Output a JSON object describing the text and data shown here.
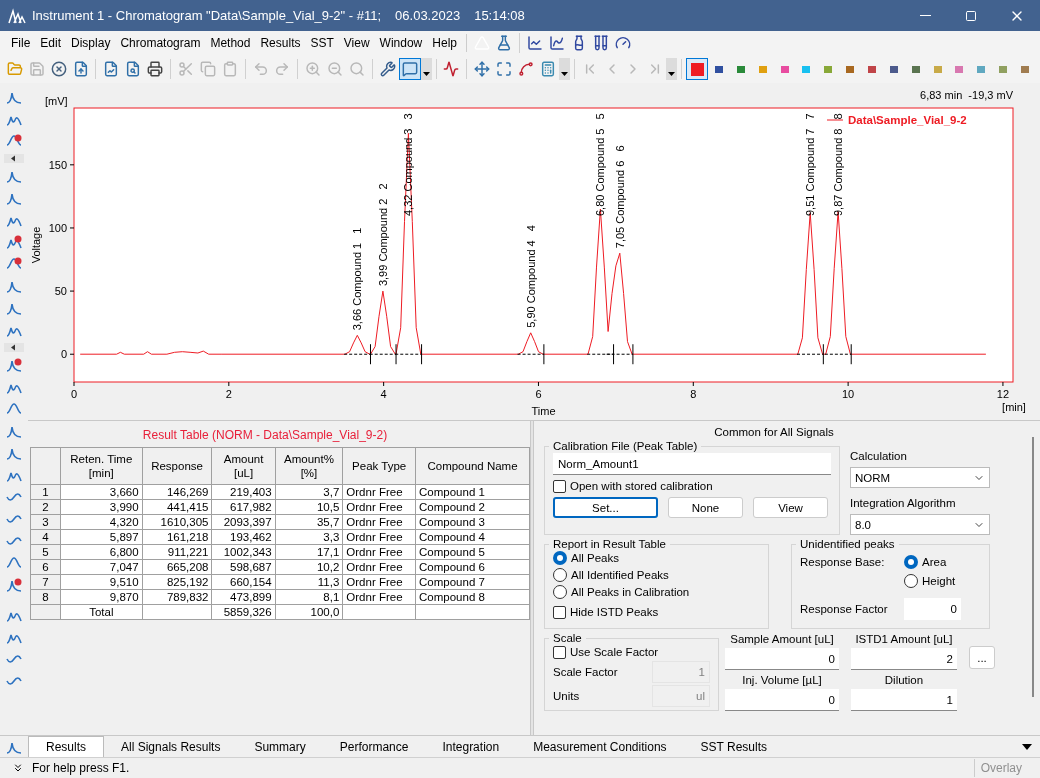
{
  "window": {
    "app": "Instrument 1 - Chromatogram \"Data\\Sample_Vial_9-2\" - #11;",
    "date": "06.03.2023",
    "time": "15:14:08"
  },
  "menu": [
    "File",
    "Edit",
    "Display",
    "Chromatogram",
    "Method",
    "Results",
    "SST",
    "View",
    "Window",
    "Help"
  ],
  "swatches": [
    {
      "color": "#ee1c24",
      "selected": true
    },
    {
      "color": "#3050a0",
      "selected": false
    },
    {
      "color": "#2a8a3a",
      "selected": false
    },
    {
      "color": "#e0a010",
      "selected": false
    },
    {
      "color": "#e84ca0",
      "selected": false
    },
    {
      "color": "#18c0f0",
      "selected": false
    },
    {
      "color": "#88a838",
      "selected": false
    },
    {
      "color": "#a86820",
      "selected": false
    },
    {
      "color": "#c04448",
      "selected": false
    },
    {
      "color": "#4c5a8c",
      "selected": false
    },
    {
      "color": "#5a7450",
      "selected": false
    },
    {
      "color": "#c8aa48",
      "selected": false
    },
    {
      "color": "#d878b0",
      "selected": false
    },
    {
      "color": "#60a8c0",
      "selected": false
    },
    {
      "color": "#90a060",
      "selected": false
    },
    {
      "color": "#a07c50",
      "selected": false
    }
  ],
  "cursor_readout": "6,83 min  -19,3 mV",
  "y_unit": "[mV]",
  "x_unit": "[min]",
  "chart_data": {
    "type": "line",
    "xlabel": "Time",
    "ylabel": "Voltage",
    "xlim": [
      0,
      12.13
    ],
    "ylim": [
      -22,
      195
    ],
    "xticks": [
      0,
      2,
      4,
      6,
      8,
      10,
      12
    ],
    "yticks": [
      0,
      50,
      100,
      150
    ],
    "x": [
      0.08,
      0.55,
      0.6,
      0.65,
      0.9,
      0.95,
      1.0,
      1.2,
      1.3,
      1.4,
      1.5,
      1.6,
      1.67,
      1.74,
      1.9,
      3.5,
      3.56,
      3.61,
      3.66,
      3.71,
      3.76,
      3.82,
      3.83,
      3.89,
      3.94,
      3.99,
      4.04,
      4.09,
      4.15,
      4.16,
      4.22,
      4.27,
      4.32,
      4.37,
      4.42,
      4.48,
      5.74,
      5.8,
      5.85,
      5.9,
      5.95,
      6.0,
      6.06,
      6.64,
      6.7,
      6.75,
      6.8,
      6.85,
      6.9,
      6.95,
      7.0,
      7.05,
      7.1,
      7.15,
      7.21,
      9.35,
      9.41,
      9.46,
      9.51,
      9.56,
      9.61,
      9.67,
      9.71,
      9.77,
      9.82,
      9.87,
      9.92,
      9.97,
      10.03,
      11.78
    ],
    "series": [
      {
        "name": "Data\\Sample_Vial_9-2",
        "color": "#ee1c24",
        "values": [
          0,
          0,
          1.5,
          0,
          0,
          2,
          0,
          0,
          1.5,
          2,
          1.5,
          1,
          2.5,
          0,
          0,
          0,
          2,
          9,
          15,
          9,
          2,
          0,
          0,
          6,
          30,
          50,
          30,
          6,
          0,
          0,
          21,
          105,
          175,
          105,
          21,
          0,
          0,
          2,
          10,
          17,
          10,
          2,
          0,
          0,
          14,
          69,
          115,
          69,
          18,
          48,
          70,
          80,
          48,
          10,
          0,
          0,
          13,
          67,
          112,
          67,
          13,
          0,
          0,
          14,
          68,
          113,
          68,
          14,
          0,
          0
        ]
      }
    ],
    "annotations": [
      "3,66 Compound 1   1",
      "3,99 Compound 2   2",
      "4,32 Compound 3   3",
      "5,90 Compound 4   4",
      "6,80 Compound 5   5",
      "7,05 Compound 6   6",
      "9,51 Compound 7   7",
      "9,87 Compound 8   8"
    ]
  },
  "result_table": {
    "title": "Result Table (NORM - Data\\Sample_Vial_9-2)",
    "columns": [
      {
        "label": "Reten. Time",
        "unit": "[min]"
      },
      {
        "label": "Response"
      },
      {
        "label": "Amount",
        "unit": "[uL]"
      },
      {
        "label": "Amount%",
        "unit": "[%]"
      },
      {
        "label": "Peak Type"
      },
      {
        "label": "Compound Name"
      }
    ],
    "rows": [
      {
        "number": "1",
        "cells": [
          "3,660",
          "146,269",
          "219,403",
          "3,7",
          "Ordnr Free",
          "Compound 1"
        ]
      },
      {
        "number": "2",
        "cells": [
          "3,990",
          "441,415",
          "617,982",
          "10,5",
          "Ordnr Free",
          "Compound 2"
        ]
      },
      {
        "number": "3",
        "cells": [
          "4,320",
          "1610,305",
          "2093,397",
          "35,7",
          "Ordnr Free",
          "Compound 3"
        ]
      },
      {
        "number": "4",
        "cells": [
          "5,897",
          "161,218",
          "193,462",
          "3,3",
          "Ordnr Free",
          "Compound 4"
        ]
      },
      {
        "number": "5",
        "cells": [
          "6,800",
          "911,221",
          "1002,343",
          "17,1",
          "Ordnr Free",
          "Compound 5"
        ]
      },
      {
        "number": "6",
        "cells": [
          "7,047",
          "665,208",
          "598,687",
          "10,2",
          "Ordnr Free",
          "Compound 6"
        ]
      },
      {
        "number": "7",
        "cells": [
          "9,510",
          "825,192",
          "660,154",
          "11,3",
          "Ordnr Free",
          "Compound 7"
        ]
      },
      {
        "number": "8",
        "cells": [
          "9,870",
          "789,832",
          "473,899",
          "8,1",
          "Ordnr Free",
          "Compound 8"
        ]
      }
    ],
    "total": {
      "label": "Total",
      "amount": "5859,326",
      "amount_pct": "100,0"
    }
  },
  "settings": {
    "title": "Common for All Signals",
    "calibration": {
      "legend": "Calibration File (Peak Table)",
      "file": "Norm_Amount1",
      "open_stored": {
        "label": "Open with stored calibration",
        "checked": false
      },
      "buttons": [
        {
          "label": "Set...",
          "default": true
        },
        {
          "label": "None",
          "default": false
        },
        {
          "label": "View",
          "default": false
        }
      ]
    },
    "calculation": {
      "label": "Calculation",
      "value": "NORM"
    },
    "integration_algorithm": {
      "label": "Integration Algorithm",
      "value": "8.0"
    },
    "report": {
      "legend": "Report in Result Table",
      "options": [
        {
          "label": "All Peaks",
          "selected": true
        },
        {
          "label": "All Identified Peaks",
          "selected": false
        },
        {
          "label": "All Peaks in Calibration",
          "selected": false
        }
      ],
      "hide_istd": {
        "label": "Hide ISTD Peaks",
        "checked": false
      }
    },
    "unidentified": {
      "legend": "Unidentified peaks",
      "response_base": {
        "label": "Response Base:",
        "options": [
          {
            "label": "Area",
            "selected": true
          },
          {
            "label": "Height",
            "selected": false
          }
        ]
      },
      "response_factor": {
        "label": "Response Factor",
        "value": "0"
      }
    },
    "scale": {
      "legend": "Scale",
      "use_scale_factor": {
        "label": "Use Scale Factor",
        "checked": false
      },
      "fields": [
        {
          "label": "Scale Factor",
          "value": "1",
          "disabled": true
        },
        {
          "label": "Units",
          "value": "ul",
          "disabled": true
        }
      ]
    },
    "amounts": [
      {
        "label": "Sample Amount [uL]",
        "value": "0"
      },
      {
        "label": "ISTD1 Amount [uL]",
        "value": "2"
      },
      {
        "label": "Inj. Volume [µL]",
        "value": "0"
      },
      {
        "label": "Dilution",
        "value": "1"
      }
    ],
    "more_button": "..."
  },
  "tabs": [
    {
      "label": "Results",
      "selected": true
    },
    {
      "label": "All Signals Results",
      "selected": false
    },
    {
      "label": "Summary",
      "selected": false
    },
    {
      "label": "Performance",
      "selected": false
    },
    {
      "label": "Integration",
      "selected": false
    },
    {
      "label": "Measurement Conditions",
      "selected": false
    },
    {
      "label": "SST Results",
      "selected": false
    }
  ],
  "status_bar": {
    "message": "For help press F1.",
    "mode": {
      "label": "Overlay",
      "disabled": true
    }
  }
}
